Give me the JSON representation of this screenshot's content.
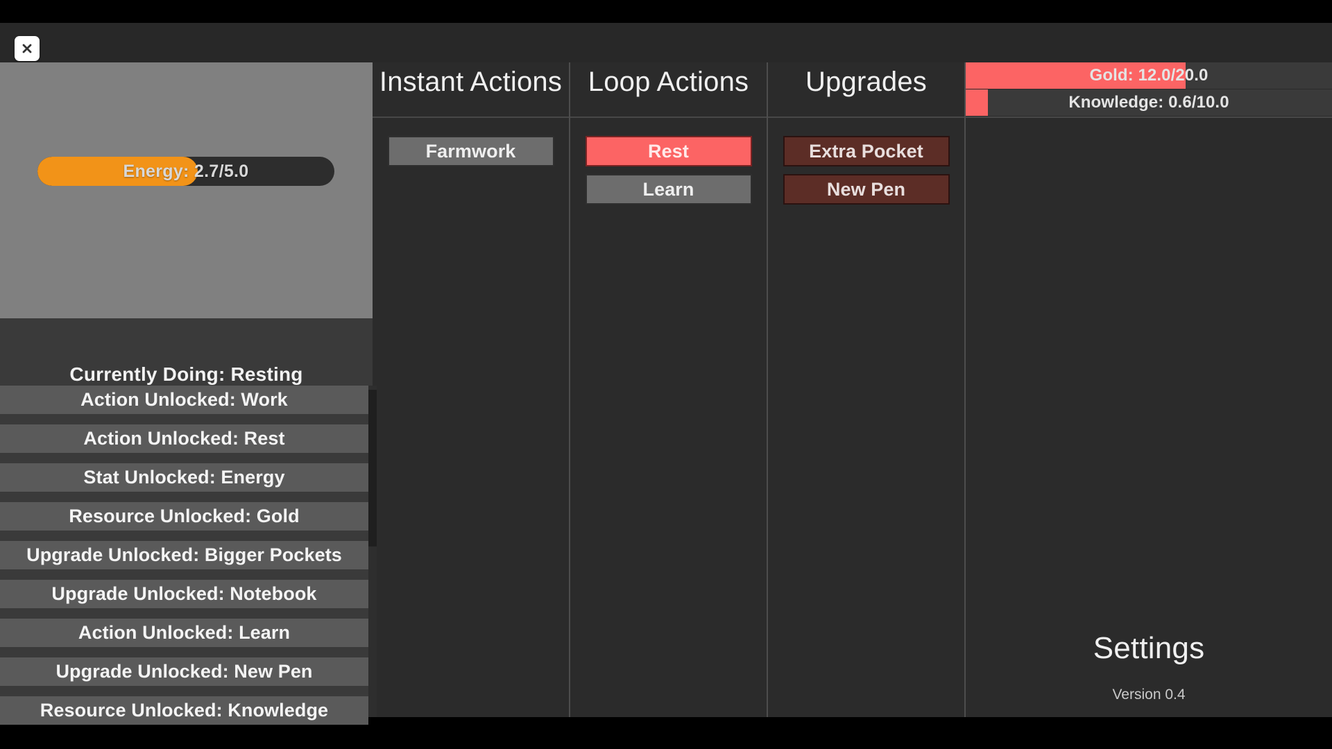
{
  "window": {
    "close_icon": "close-icon",
    "close_label": "×"
  },
  "player_panel": {
    "energy": {
      "label": "Energy: 2.7/5.0",
      "name": "Energy",
      "current": 2.7,
      "max": 5.0,
      "percent": 54,
      "fill_color": "#f29318",
      "track_color": "#2d2d2d"
    },
    "currently_doing": "Currently Doing: Resting",
    "log": [
      "Action Unlocked: Work",
      "Action Unlocked: Rest",
      "Stat Unlocked: Energy",
      "Resource Unlocked: Gold",
      "Upgrade Unlocked: Bigger Pockets",
      "Upgrade Unlocked: Notebook",
      "Action Unlocked: Learn",
      "Upgrade Unlocked: New Pen",
      "Resource Unlocked: Knowledge"
    ]
  },
  "columns": {
    "instant_actions": {
      "title": "Instant Actions",
      "buttons": [
        {
          "label": "Farmwork",
          "state": "gray"
        }
      ]
    },
    "loop_actions": {
      "title": "Loop Actions",
      "buttons": [
        {
          "label": "Rest",
          "state": "active-red"
        },
        {
          "label": "Learn",
          "state": "gray"
        }
      ]
    },
    "upgrades": {
      "title": "Upgrades",
      "buttons": [
        {
          "label": "Extra Pocket",
          "state": "upgrade"
        },
        {
          "label": "New Pen",
          "state": "upgrade"
        }
      ]
    }
  },
  "resources": {
    "gold": {
      "label": "Gold: 12.0/20.0",
      "name": "Gold",
      "current": 12.0,
      "max": 20.0,
      "percent": 60,
      "fill_color": "#fc6464"
    },
    "knowledge": {
      "label": "Knowledge: 0.6/10.0",
      "name": "Knowledge",
      "current": 0.6,
      "max": 10.0,
      "percent": 6,
      "fill_color": "#fc6464"
    },
    "settings_label": "Settings",
    "version_label": "Version 0.4"
  }
}
